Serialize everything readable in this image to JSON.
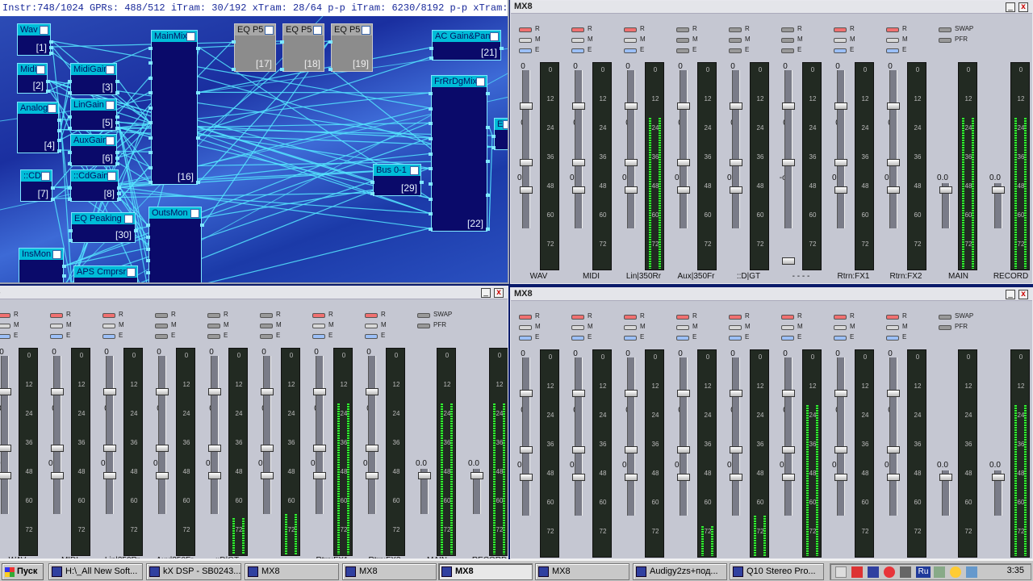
{
  "dsp": {
    "status": "Instr:748/1024 GPRs: 488/512 iTram: 30/192 xTram: 28/64 p-p iTram: 6230/8192 p-p xTram: 122/256",
    "blocks": [
      {
        "name": "Wav",
        "num": "[1]"
      },
      {
        "name": "Midi",
        "num": "[2]"
      },
      {
        "name": "Analog",
        "num": "[4]"
      },
      {
        "name": "::CD",
        "num": "[7]"
      },
      {
        "name": "InsMon",
        "num": ""
      },
      {
        "name": "MidiGain",
        "num": "[3]"
      },
      {
        "name": "LinGain",
        "num": "[5]"
      },
      {
        "name": "AuxGain",
        "num": "[6]"
      },
      {
        "name": "::CdGain",
        "num": "[8]"
      },
      {
        "name": "EQ Peaking",
        "num": "[30]"
      },
      {
        "name": "APS Cmprsr",
        "num": ""
      },
      {
        "name": "MainMix",
        "num": "[16]"
      },
      {
        "name": "OutsMon",
        "num": ""
      },
      {
        "name": "EQ P5",
        "num": "[17]"
      },
      {
        "name": "EQ P5",
        "num": "[18]"
      },
      {
        "name": "EQ P5",
        "num": "[19]"
      },
      {
        "name": "AC Gain&Pan",
        "num": "[21]"
      },
      {
        "name": "FrRrDgMix",
        "num": "[22]"
      },
      {
        "name": "Bus 0-1",
        "num": "[29]"
      },
      {
        "name": "EQ",
        "num": ""
      }
    ]
  },
  "mixer": {
    "title": "MX8",
    "title_cut": "X8",
    "rme": [
      "R",
      "M",
      "E"
    ],
    "swap": "SWAP",
    "pfr": "PFR",
    "top_val": "0",
    "mid_val": "0",
    "low_val": "0.0",
    "inf_val": "-oo",
    "meter_ticks": [
      "0",
      "12",
      "24",
      "36",
      "48",
      "60",
      "72"
    ],
    "strips": [
      "WAV",
      "MIDI",
      "Lin|350Rr",
      "Aux|350Fr",
      "::D|GT",
      "- - - -",
      "Rtrn:FX1",
      "Rtrn:FX2"
    ],
    "main_label": "MAIN",
    "record_label": "RECORD",
    "btn_min": "_",
    "btn_close": "x"
  },
  "taskbar": {
    "start": "Пуск",
    "items": [
      "H:\\_All New Soft...",
      "kX DSP - SB0243...",
      "MX8",
      "MX8",
      "MX8",
      "MX8",
      "Audigy2zs+под...",
      "Q10 Stereo Pro..."
    ],
    "lang": "Ru",
    "time": "3:35"
  },
  "colors": {
    "wire": "#55e6ff",
    "block_header": "#00bcd8",
    "meter_led": "#33ee33"
  }
}
